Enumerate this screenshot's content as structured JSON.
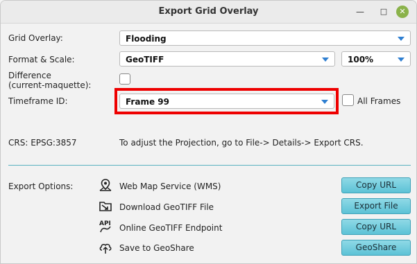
{
  "window": {
    "title": "Export Grid Overlay"
  },
  "grid_overlay": {
    "label": "Grid Overlay:",
    "value": "Flooding"
  },
  "format_scale": {
    "label": "Format & Scale:",
    "format": "GeoTIFF",
    "scale": "100%"
  },
  "difference": {
    "label_line1": "Difference",
    "label_line2": "(current-maquette):",
    "checked": false
  },
  "timeframe": {
    "label": "Timeframe ID:",
    "value": "Frame 99",
    "all_frames_label": "All Frames",
    "all_frames_checked": false
  },
  "crs": {
    "label": "CRS: EPSG:3857",
    "hint": "To adjust the Projection, go to File-> Details-> Export CRS."
  },
  "export_options": {
    "label": "Export Options:",
    "options": [
      {
        "icon": "map-pin-icon",
        "text": "Web Map Service (WMS)",
        "button": "Copy URL"
      },
      {
        "icon": "download-folder-icon",
        "text": "Download GeoTIFF File",
        "button": "Export File"
      },
      {
        "icon": "api-icon",
        "text": "Online GeoTIFF Endpoint",
        "button": "Copy URL"
      },
      {
        "icon": "cloud-upload-icon",
        "text": "Save to GeoShare",
        "button": "GeoShare"
      }
    ]
  },
  "colors": {
    "accent": "#5cc2d6",
    "highlight": "#ee0000",
    "caret": "#2f7fd1",
    "close": "#8ab24a"
  }
}
